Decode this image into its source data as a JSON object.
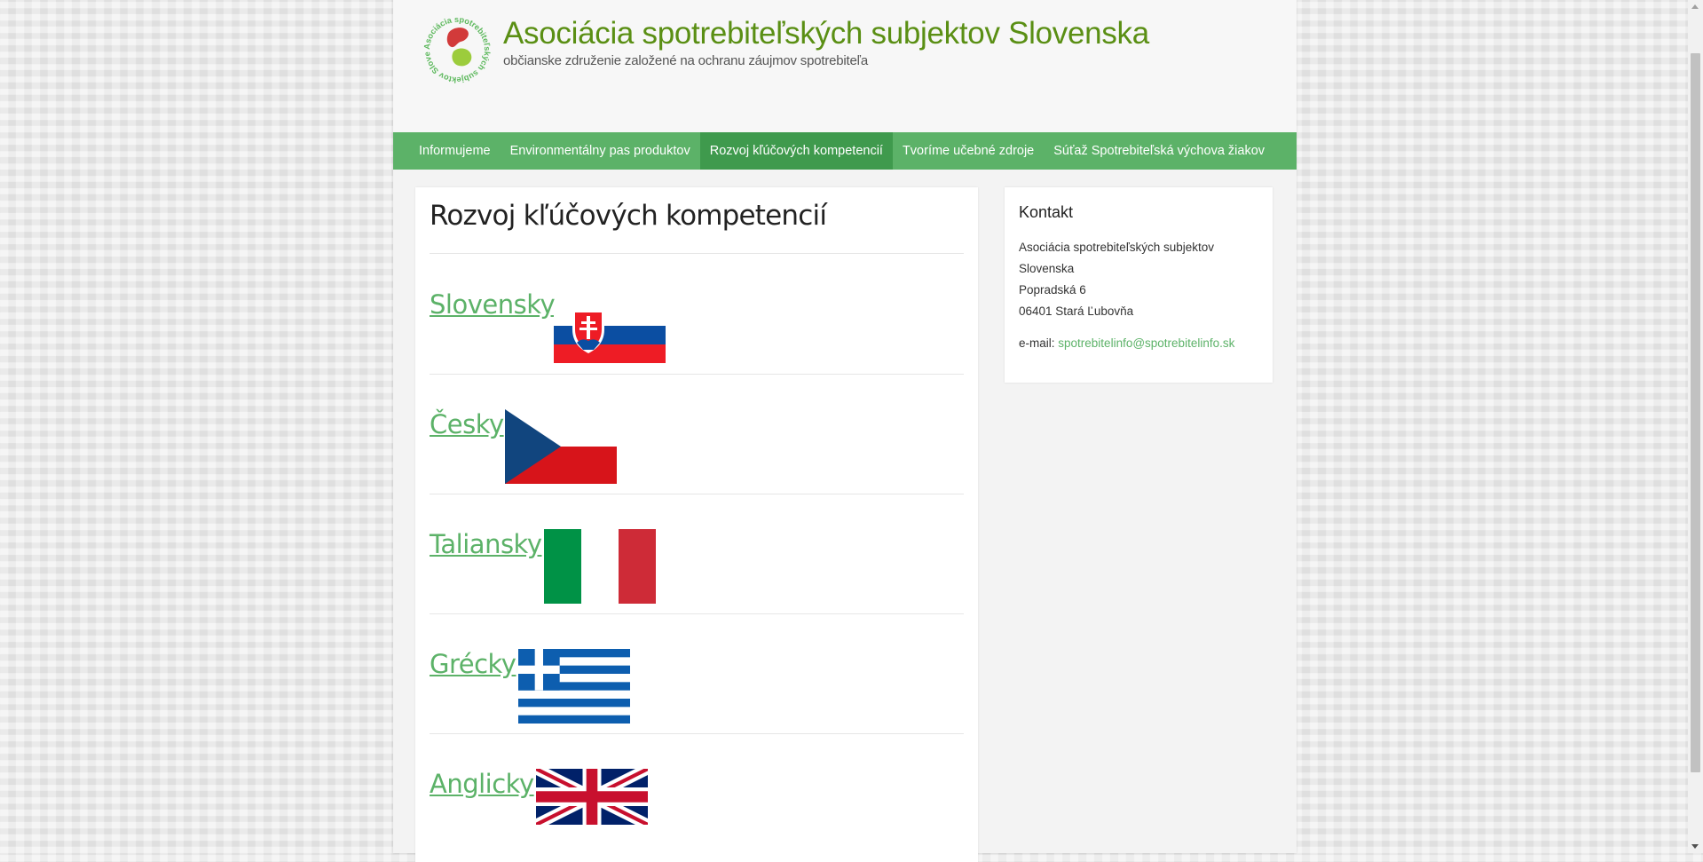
{
  "header": {
    "title": "Asociácia spotrebiteľských subjektov Slovenska",
    "tagline": "občianske združenie založené na ochranu záujmov spotrebiteľa",
    "logo_text": "Asociácia spotrebiteľských subjektov Slovenska"
  },
  "nav": {
    "items": [
      {
        "label": "Informujeme"
      },
      {
        "label": "Environmentálny pas produktov"
      },
      {
        "label": "Rozvoj kľúčových kompetencií"
      },
      {
        "label": "Tvoríme učebné zdroje"
      },
      {
        "label": "Súťaž Spotrebiteľská výchova žiakov"
      }
    ],
    "active_index": 2
  },
  "main": {
    "title": "Rozvoj kľúčových kompetencií",
    "languages": [
      {
        "label": "Slovensky",
        "flag": "slovak-flag"
      },
      {
        "label": "Česky",
        "flag": "czech-flag"
      },
      {
        "label": "Taliansky",
        "flag": "italian-flag"
      },
      {
        "label": "Grécky",
        "flag": "greek-flag"
      },
      {
        "label": "Anglicky",
        "flag": "uk-flag"
      }
    ]
  },
  "sidebar": {
    "title": "Kontakt",
    "address_lines": [
      "Asociácia spotrebiteľských subjektov",
      "Slovenska",
      "Popradská 6",
      "06401 Stará Ľubovňa"
    ],
    "email_label": "e-mail:",
    "email": "spotrebitelinfo@spotrebitelinfo.sk"
  },
  "colors": {
    "accent": "#5cb268",
    "nav_active": "#3f9a4d",
    "title_green": "#5a8f14"
  }
}
